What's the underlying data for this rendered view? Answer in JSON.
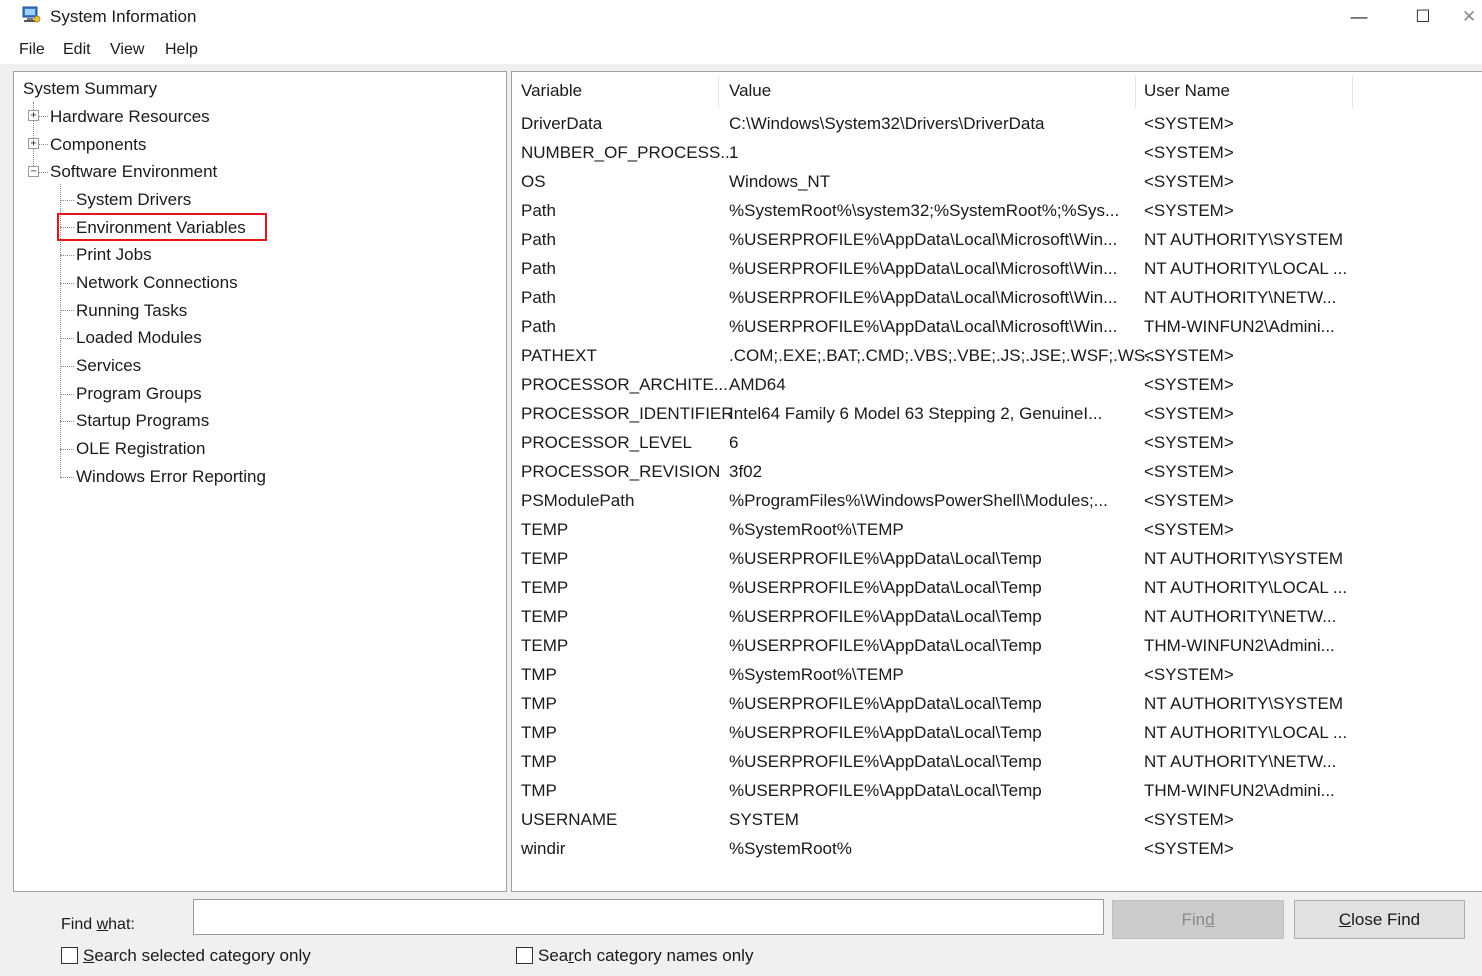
{
  "window": {
    "title": "System Information",
    "app_icon": "system-information-icon",
    "controls": {
      "minimize": "—",
      "maximize": "☐",
      "close": "✕"
    }
  },
  "menu": [
    {
      "label": "File"
    },
    {
      "label": "Edit"
    },
    {
      "label": "View"
    },
    {
      "label": "Help"
    }
  ],
  "tree": {
    "root": "System Summary",
    "nodes": [
      {
        "label": "Hardware Resources",
        "expander": "+"
      },
      {
        "label": "Components",
        "expander": "+"
      },
      {
        "label": "Software Environment",
        "expander": "−"
      }
    ],
    "software_children": [
      "System Drivers",
      "Environment Variables",
      "Print Jobs",
      "Network Connections",
      "Running Tasks",
      "Loaded Modules",
      "Services",
      "Program Groups",
      "Startup Programs",
      "OLE Registration",
      "Windows Error Reporting"
    ],
    "selected": "Environment Variables",
    "highlight_color": "#e0181e"
  },
  "table": {
    "columns": [
      "Variable",
      "Value",
      "User Name"
    ],
    "rows": [
      [
        "DriverData",
        "C:\\Windows\\System32\\Drivers\\DriverData",
        "<SYSTEM>"
      ],
      [
        "NUMBER_OF_PROCESS...",
        "1",
        "<SYSTEM>"
      ],
      [
        "OS",
        "Windows_NT",
        "<SYSTEM>"
      ],
      [
        "Path",
        "%SystemRoot%\\system32;%SystemRoot%;%Sys...",
        "<SYSTEM>"
      ],
      [
        "Path",
        "%USERPROFILE%\\AppData\\Local\\Microsoft\\Win...",
        "NT AUTHORITY\\SYSTEM"
      ],
      [
        "Path",
        "%USERPROFILE%\\AppData\\Local\\Microsoft\\Win...",
        "NT AUTHORITY\\LOCAL ..."
      ],
      [
        "Path",
        "%USERPROFILE%\\AppData\\Local\\Microsoft\\Win...",
        "NT AUTHORITY\\NETW..."
      ],
      [
        "Path",
        "%USERPROFILE%\\AppData\\Local\\Microsoft\\Win...",
        "THM-WINFUN2\\Admini..."
      ],
      [
        "PATHEXT",
        ".COM;.EXE;.BAT;.CMD;.VBS;.VBE;.JS;.JSE;.WSF;.WS...",
        "<SYSTEM>"
      ],
      [
        "PROCESSOR_ARCHITE...",
        "AMD64",
        "<SYSTEM>"
      ],
      [
        "PROCESSOR_IDENTIFIER",
        "Intel64 Family 6 Model 63 Stepping 2, GenuineI...",
        "<SYSTEM>"
      ],
      [
        "PROCESSOR_LEVEL",
        "6",
        "<SYSTEM>"
      ],
      [
        "PROCESSOR_REVISION",
        "3f02",
        "<SYSTEM>"
      ],
      [
        "PSModulePath",
        "%ProgramFiles%\\WindowsPowerShell\\Modules;...",
        "<SYSTEM>"
      ],
      [
        "TEMP",
        "%SystemRoot%\\TEMP",
        "<SYSTEM>"
      ],
      [
        "TEMP",
        "%USERPROFILE%\\AppData\\Local\\Temp",
        "NT AUTHORITY\\SYSTEM"
      ],
      [
        "TEMP",
        "%USERPROFILE%\\AppData\\Local\\Temp",
        "NT AUTHORITY\\LOCAL ..."
      ],
      [
        "TEMP",
        "%USERPROFILE%\\AppData\\Local\\Temp",
        "NT AUTHORITY\\NETW..."
      ],
      [
        "TEMP",
        "%USERPROFILE%\\AppData\\Local\\Temp",
        "THM-WINFUN2\\Admini..."
      ],
      [
        "TMP",
        "%SystemRoot%\\TEMP",
        "<SYSTEM>"
      ],
      [
        "TMP",
        "%USERPROFILE%\\AppData\\Local\\Temp",
        "NT AUTHORITY\\SYSTEM"
      ],
      [
        "TMP",
        "%USERPROFILE%\\AppData\\Local\\Temp",
        "NT AUTHORITY\\LOCAL ..."
      ],
      [
        "TMP",
        "%USERPROFILE%\\AppData\\Local\\Temp",
        "NT AUTHORITY\\NETW..."
      ],
      [
        "TMP",
        "%USERPROFILE%\\AppData\\Local\\Temp",
        "THM-WINFUN2\\Admini..."
      ],
      [
        "USERNAME",
        "SYSTEM",
        "<SYSTEM>"
      ],
      [
        "windir",
        "%SystemRoot%",
        "<SYSTEM>"
      ]
    ]
  },
  "find": {
    "label_pre": "Find ",
    "label_key": "w",
    "label_post": "hat:",
    "value": "",
    "find_button": {
      "pre": "Fin",
      "key": "d",
      "post": ""
    },
    "close_find_button": {
      "pre": "",
      "key": "C",
      "post": "lose Find"
    },
    "search_selected": {
      "pre": "",
      "key": "S",
      "post": "earch selected category only",
      "checked": false
    },
    "search_names": {
      "pre": "Sea",
      "key": "r",
      "post": "ch category names only",
      "checked": false
    }
  }
}
